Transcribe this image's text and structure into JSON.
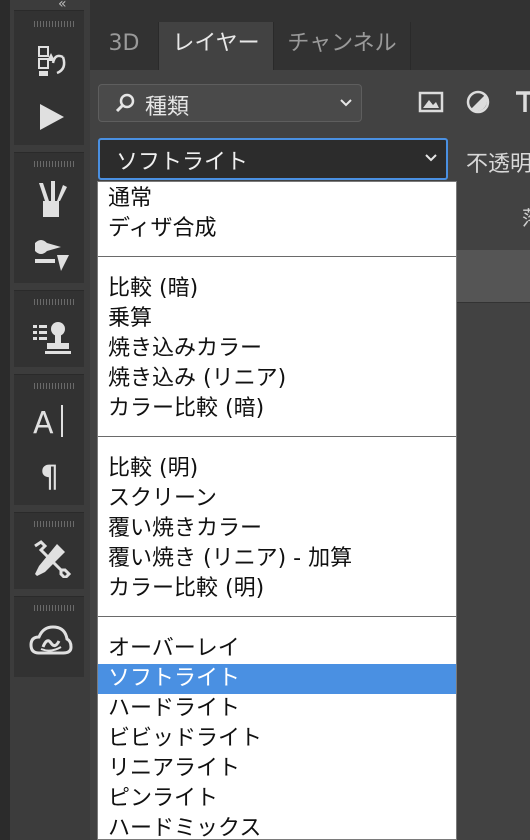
{
  "panel": {
    "tabs": [
      {
        "label": "3D",
        "active": false
      },
      {
        "label": "レイヤー",
        "active": true
      },
      {
        "label": "チャンネル",
        "active": false
      }
    ],
    "filter": {
      "label": "種類",
      "icon": "search-icon"
    },
    "filter_icons": [
      "image-filter-icon",
      "adjustment-filter-icon",
      "type-filter-icon"
    ],
    "blend_mode": {
      "selected": "ソフトライト"
    },
    "opacity_label": "不透明",
    "layer_header_partial": "落"
  },
  "tools": [
    "history-brush-icon",
    "play-icon",
    "brushes-icon",
    "tool-presets-icon",
    "clone-source-icon",
    "character-icon",
    "paragraph-icon",
    "tool-settings-icon",
    "creative-cloud-icon"
  ],
  "blend_menu": {
    "groups": [
      [
        "通常",
        "ディザ合成"
      ],
      [
        "比較 (暗)",
        "乗算",
        "焼き込みカラー",
        "焼き込み (リニア)",
        "カラー比較 (暗)"
      ],
      [
        "比較 (明)",
        "スクリーン",
        "覆い焼きカラー",
        "覆い焼き (リニア) - 加算",
        "カラー比較 (明)"
      ],
      [
        "オーバーレイ",
        "ソフトライト",
        "ハードライト",
        "ビビッドライト",
        "リニアライト",
        "ピンライト",
        "ハードミックス"
      ]
    ],
    "selected": "ソフトライト",
    "colors": {
      "highlight": "#4a90e2",
      "text": "#111111"
    }
  }
}
